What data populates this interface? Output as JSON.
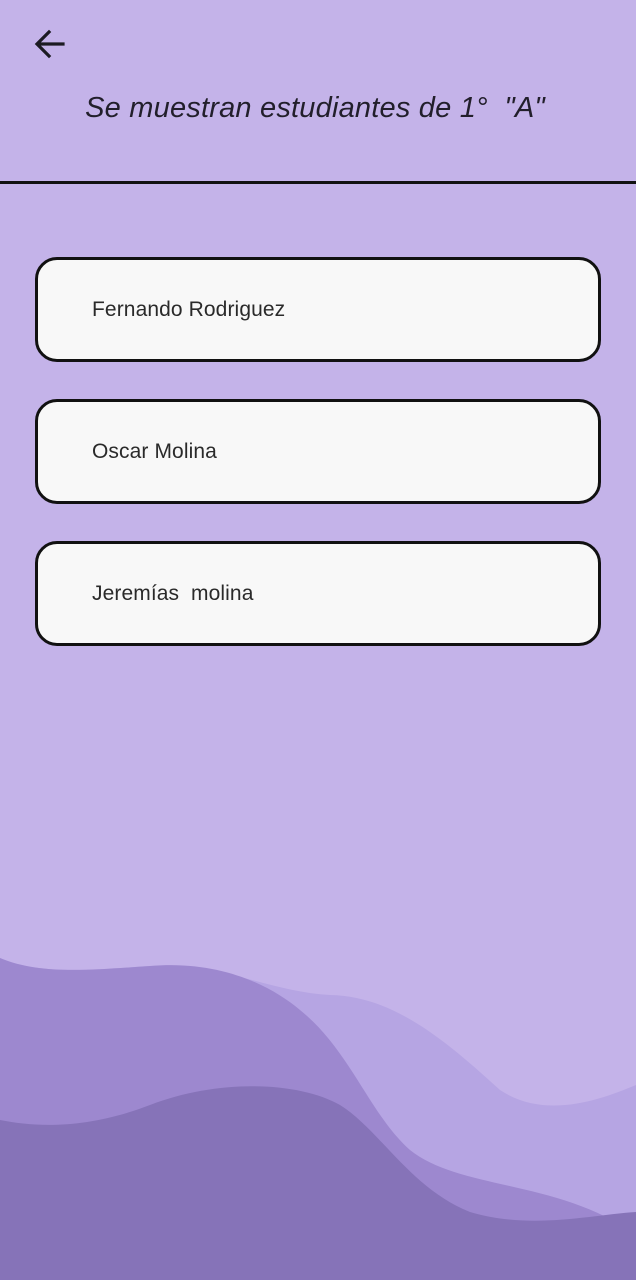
{
  "header": {
    "back_icon": "arrow-left-icon",
    "title": "Se muestran estudiantes de 1°  \"A\""
  },
  "students": [
    {
      "name": "Fernando Rodriguez"
    },
    {
      "name": "Oscar Molina"
    },
    {
      "name": "Jeremías  molina"
    }
  ],
  "colors": {
    "background": "#c4b3e9",
    "card": "#f8f8f8",
    "card_border": "#111111",
    "wave_light": "#b6a5e3",
    "wave_mid": "#9d88cf",
    "wave_dark": "#8673b8"
  }
}
